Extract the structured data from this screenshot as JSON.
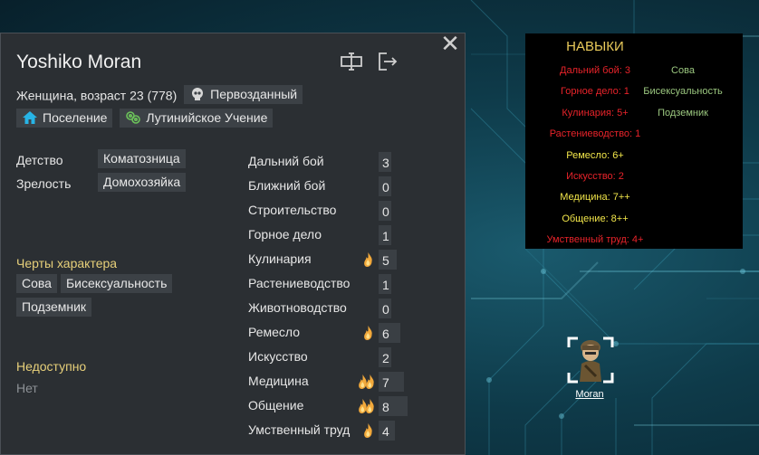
{
  "character": {
    "name": "Yoshiko Moran",
    "gender_age": "Женщина, возраст 23 (778)",
    "xenotype": "Первозданный",
    "faction": "Поселение",
    "ideology": "Лутинийское Учение"
  },
  "backstory": {
    "childhood_label": "Детство",
    "childhood_value": "Коматозница",
    "adulthood_label": "Зрелость",
    "adulthood_value": "Домохозяйка"
  },
  "traits": {
    "title": "Черты характера",
    "items": [
      "Сова",
      "Бисексуальность",
      "Подземник"
    ]
  },
  "incapable": {
    "title": "Недоступно",
    "value": "Нет"
  },
  "skills": [
    {
      "name": "Дальний бой",
      "value": "3",
      "passion": 0
    },
    {
      "name": "Ближний бой",
      "value": "0",
      "passion": 0
    },
    {
      "name": "Строительство",
      "value": "0",
      "passion": 0
    },
    {
      "name": "Горное дело",
      "value": "1",
      "passion": 0
    },
    {
      "name": "Кулинария",
      "value": "5",
      "passion": 1
    },
    {
      "name": "Растениеводство",
      "value": "1",
      "passion": 0
    },
    {
      "name": "Животноводство",
      "value": "0",
      "passion": 0
    },
    {
      "name": "Ремесло",
      "value": "6",
      "passion": 1
    },
    {
      "name": "Искусство",
      "value": "2",
      "passion": 0
    },
    {
      "name": "Медицина",
      "value": "7",
      "passion": 2
    },
    {
      "name": "Общение",
      "value": "8",
      "passion": 2
    },
    {
      "name": "Умственный труд",
      "value": "4",
      "passion": 1
    }
  ],
  "overlay": {
    "title": "НАВЫКИ",
    "skills": [
      {
        "text": "Дальний бой: 3",
        "color": "#e8232a"
      },
      {
        "text": "Горное дело: 1",
        "color": "#e8232a"
      },
      {
        "text": "Кулинария: 5+",
        "color": "#e8232a"
      },
      {
        "text": "Растениеводство: 1",
        "color": "#e8232a"
      },
      {
        "text": "Ремесло: 6+",
        "color": "#f2e64a"
      },
      {
        "text": "Искусство: 2",
        "color": "#e8232a"
      },
      {
        "text": "Медицина: 7++",
        "color": "#f2e64a"
      },
      {
        "text": "Общение: 8++",
        "color": "#f2e64a"
      },
      {
        "text": "Умственный труд: 4+",
        "color": "#e8232a"
      }
    ],
    "traits": [
      {
        "text": "Сова",
        "color": "#9bc77f"
      },
      {
        "text": "Бисексуальность",
        "color": "#9bc77f"
      },
      {
        "text": "Подземник",
        "color": "#9bc77f"
      }
    ]
  },
  "pawn": {
    "label": "Moran"
  },
  "icons": {
    "close": "close-icon",
    "rename": "rename-icon",
    "banish": "banish-icon",
    "xenotype": "skull-icon",
    "faction": "home-icon",
    "ideology": "ideology-icon",
    "passion": "flame-icon"
  },
  "colors": {
    "panel_bg": "#2b2f33",
    "tag_bg": "#3c4146",
    "section_title": "#e7d07a",
    "passion": "#f2a93b"
  }
}
